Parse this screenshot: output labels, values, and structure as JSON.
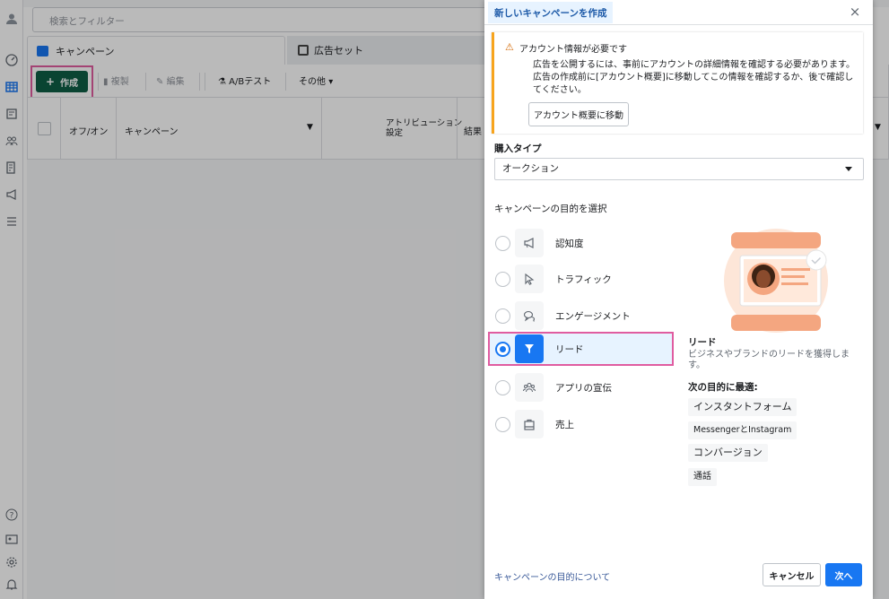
{
  "background": {
    "search_placeholder": "検索とフィルター",
    "tabs": [
      {
        "label": "キャンペーン"
      },
      {
        "label": "広告セット"
      }
    ],
    "toolbar": {
      "create": "作成",
      "duplicate": "複製",
      "edit": "編集",
      "ab_test": "A/Bテスト",
      "more": "その他"
    },
    "table_headers": {
      "onoff": "オフ/オン",
      "campaign": "キャンペーン",
      "attribution_line1": "アトリビューション",
      "attribution_line2": "設定",
      "results": "結果"
    }
  },
  "modal": {
    "title": "新しいキャンペーンを作成",
    "warning": {
      "title": "アカウント情報が必要です",
      "text": "広告を公開するには、事前にアカウントの詳細情報を確認する必要があります。広告の作成前に[アカウント概要]に移動してこの情報を確認するか、後で確認してください。",
      "button": "アカウント概要に移動"
    },
    "purchase_type": {
      "label": "購入タイプ",
      "value": "オークション"
    },
    "objective_label": "キャンペーンの目的を選択",
    "objectives": [
      {
        "label": "認知度",
        "icon": "megaphone-icon",
        "selected": false
      },
      {
        "label": "トラフィック",
        "icon": "cursor-icon",
        "selected": false
      },
      {
        "label": "エンゲージメント",
        "icon": "chat-bubbles-icon",
        "selected": false
      },
      {
        "label": "リード",
        "icon": "funnel-icon",
        "selected": true
      },
      {
        "label": "アプリの宣伝",
        "icon": "people-icon",
        "selected": false
      },
      {
        "label": "売上",
        "icon": "shopping-bag-icon",
        "selected": false
      }
    ],
    "detail": {
      "title": "リード",
      "description": "ビジネスやブランドのリードを獲得します。",
      "best_for_label": "次の目的に最適:",
      "chips": [
        "インスタントフォーム",
        "MessengerとInstagram",
        "コンバージョン",
        "通話"
      ]
    },
    "footer": {
      "link": "キャンペーンの目的について",
      "cancel": "キャンセル",
      "next": "次へ"
    }
  },
  "colors": {
    "primary": "#1877f2",
    "create_button": "#0e5e45",
    "highlight": "#e05ca0",
    "warning": "#f7a41d",
    "illustration": "#f4a680"
  }
}
